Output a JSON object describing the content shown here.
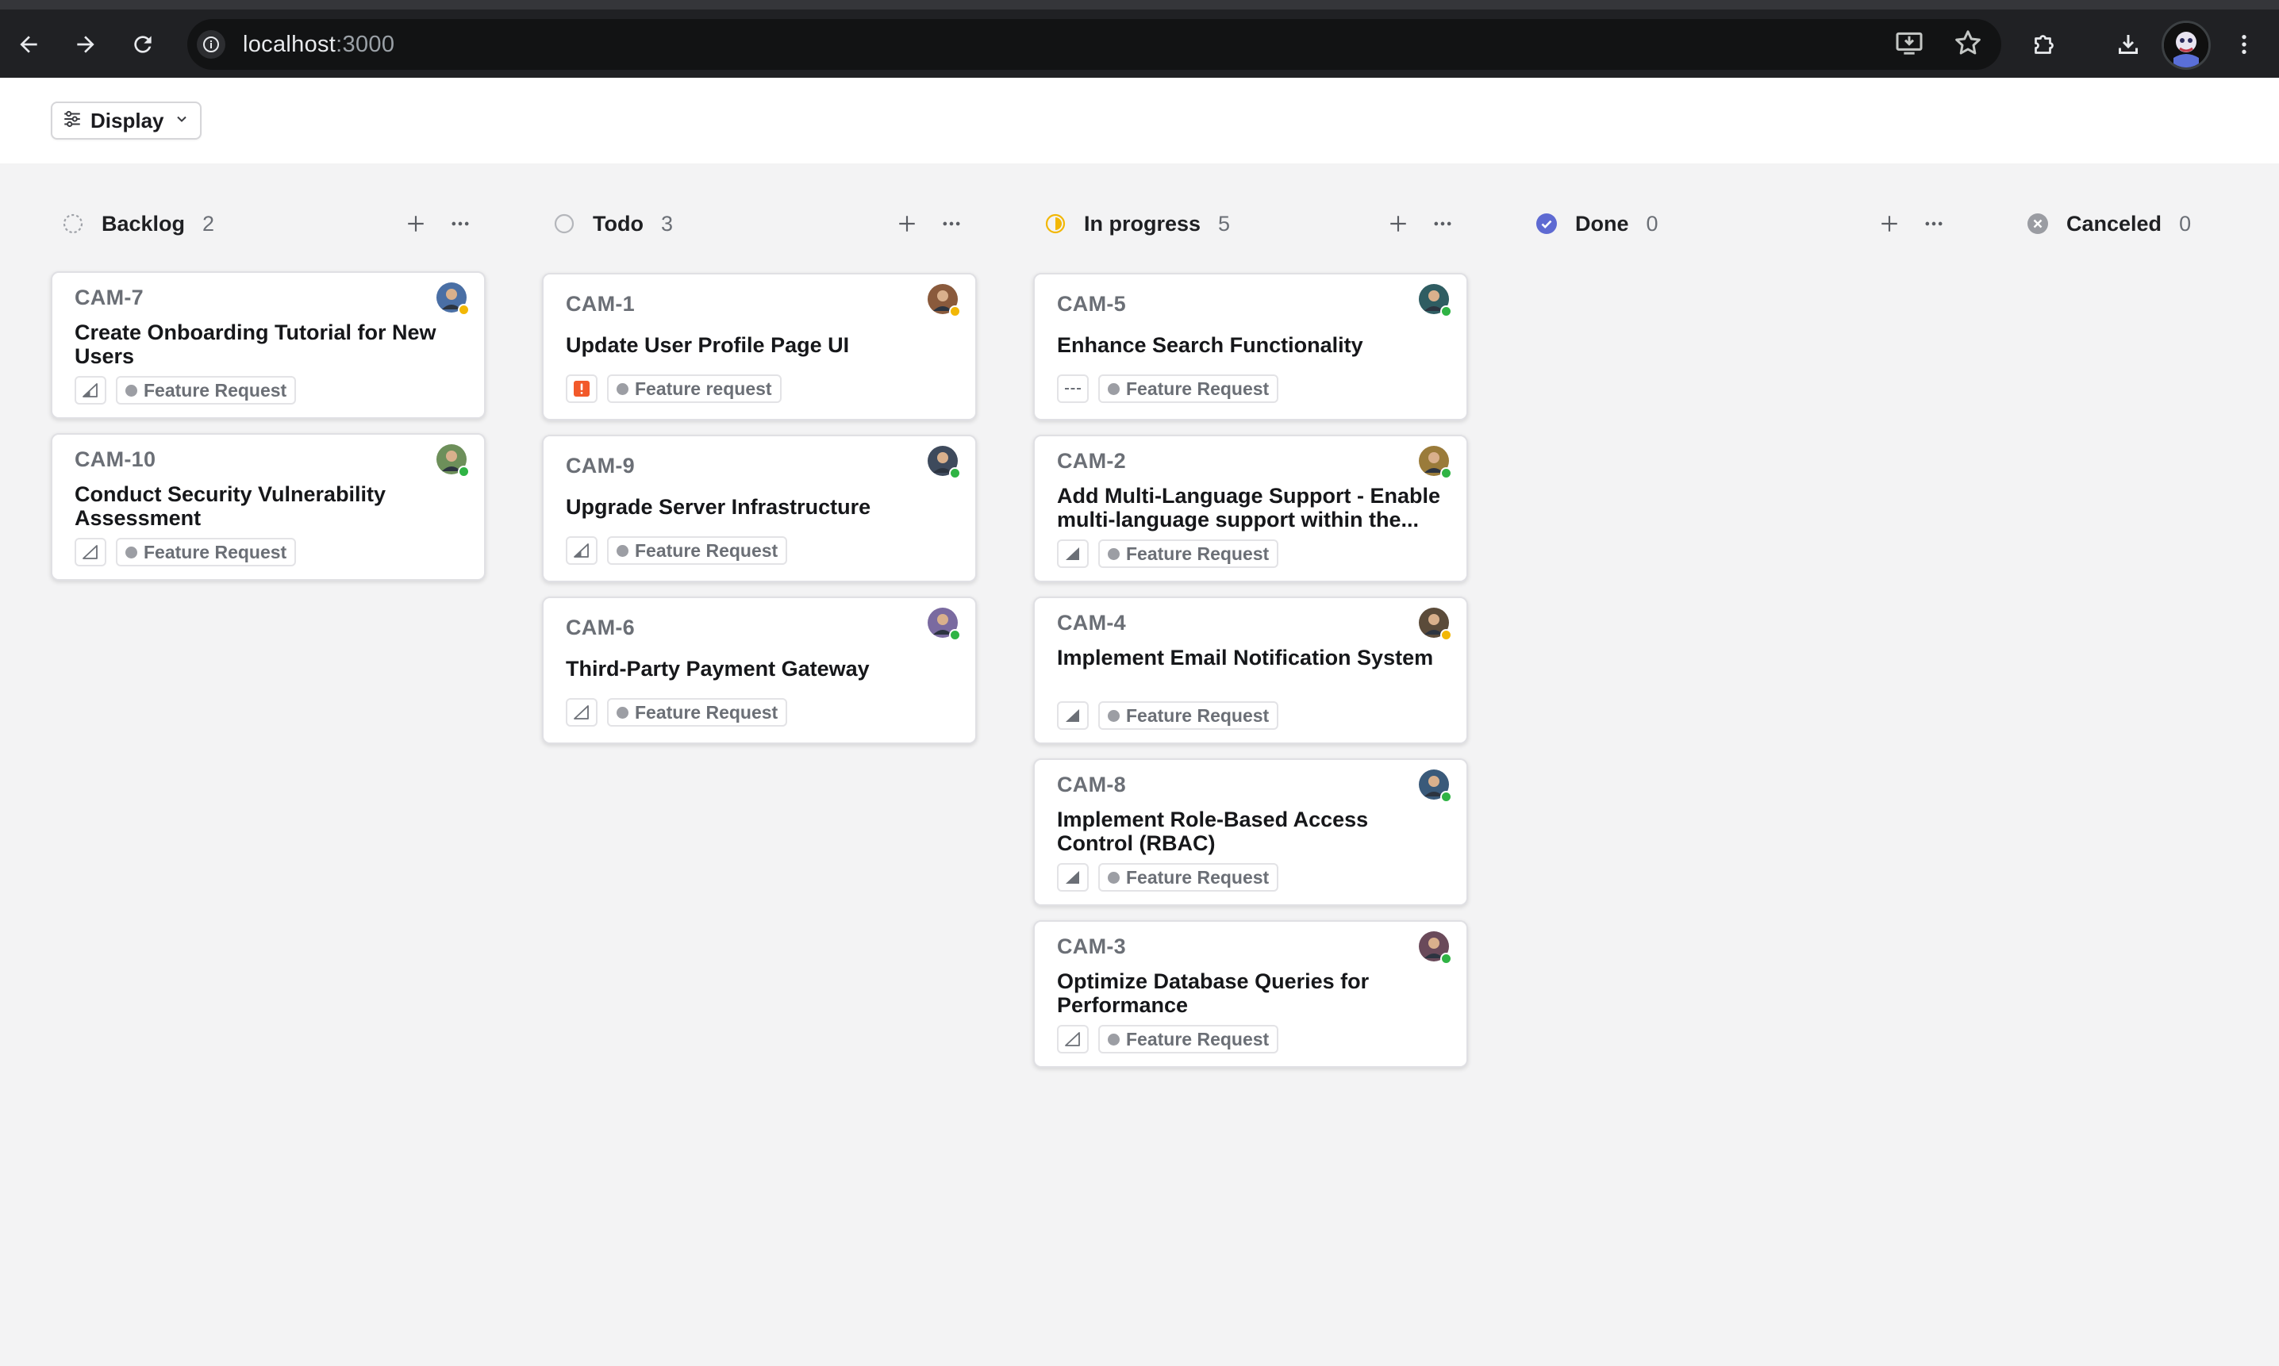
{
  "browser": {
    "url_host": "localhost",
    "url_port": ":3000"
  },
  "toolbar": {
    "display_label": "Display"
  },
  "colors": {
    "canvas": "#f3f3f4",
    "in_progress": "#f2b705",
    "done": "#5e6ad2",
    "urgent": "#f2592a",
    "online": "#2fb344",
    "away": "#f2b705"
  },
  "columns": [
    {
      "name": "Backlog",
      "count": "2",
      "icon": "backlog-dashed-circle-icon",
      "cards": [
        {
          "id": "CAM-7",
          "title": "Create Onboarding Tutorial for New Users",
          "priority": "medium-priority-icon",
          "label": "Feature Request",
          "avatar_status": "away"
        },
        {
          "id": "CAM-10",
          "title": "Conduct Security Vulnerability Assessment",
          "priority": "low-priority-icon",
          "label": "Feature Request",
          "avatar_status": "online"
        }
      ]
    },
    {
      "name": "Todo",
      "count": "3",
      "icon": "todo-circle-icon",
      "cards": [
        {
          "id": "CAM-1",
          "title": "Update User Profile Page UI",
          "priority": "urgent-priority-icon",
          "label": "Feature request",
          "avatar_status": "away"
        },
        {
          "id": "CAM-9",
          "title": "Upgrade Server Infrastructure",
          "priority": "medium-priority-icon",
          "label": "Feature Request",
          "avatar_status": "online"
        },
        {
          "id": "CAM-6",
          "title": "Third-Party Payment Gateway",
          "priority": "low-priority-icon",
          "label": "Feature Request",
          "avatar_status": "online"
        }
      ]
    },
    {
      "name": "In progress",
      "count": "5",
      "icon": "in-progress-half-circle-icon",
      "cards": [
        {
          "id": "CAM-5",
          "title": "Enhance Search Functionality",
          "priority": "no-priority-icon",
          "label": "Feature Request",
          "avatar_status": "online"
        },
        {
          "id": "CAM-2",
          "title": "Add Multi-Language Support - Enable multi-language support within the...",
          "priority": "high-priority-icon",
          "label": "Feature Request",
          "avatar_status": "online"
        },
        {
          "id": "CAM-4",
          "title": "Implement Email Notification System",
          "priority": "high-priority-icon",
          "label": "Feature Request",
          "avatar_status": "away"
        },
        {
          "id": "CAM-8",
          "title": "Implement Role-Based Access Control (RBAC)",
          "priority": "high-priority-icon",
          "label": "Feature Request",
          "avatar_status": "online"
        },
        {
          "id": "CAM-3",
          "title": "Optimize Database Queries for Performance",
          "priority": "low-priority-icon",
          "label": "Feature Request",
          "avatar_status": "online"
        }
      ]
    },
    {
      "name": "Done",
      "count": "0",
      "icon": "done-check-circle-icon",
      "cards": []
    },
    {
      "name": "Canceled",
      "count": "0",
      "icon": "canceled-x-circle-icon",
      "cards": []
    }
  ]
}
